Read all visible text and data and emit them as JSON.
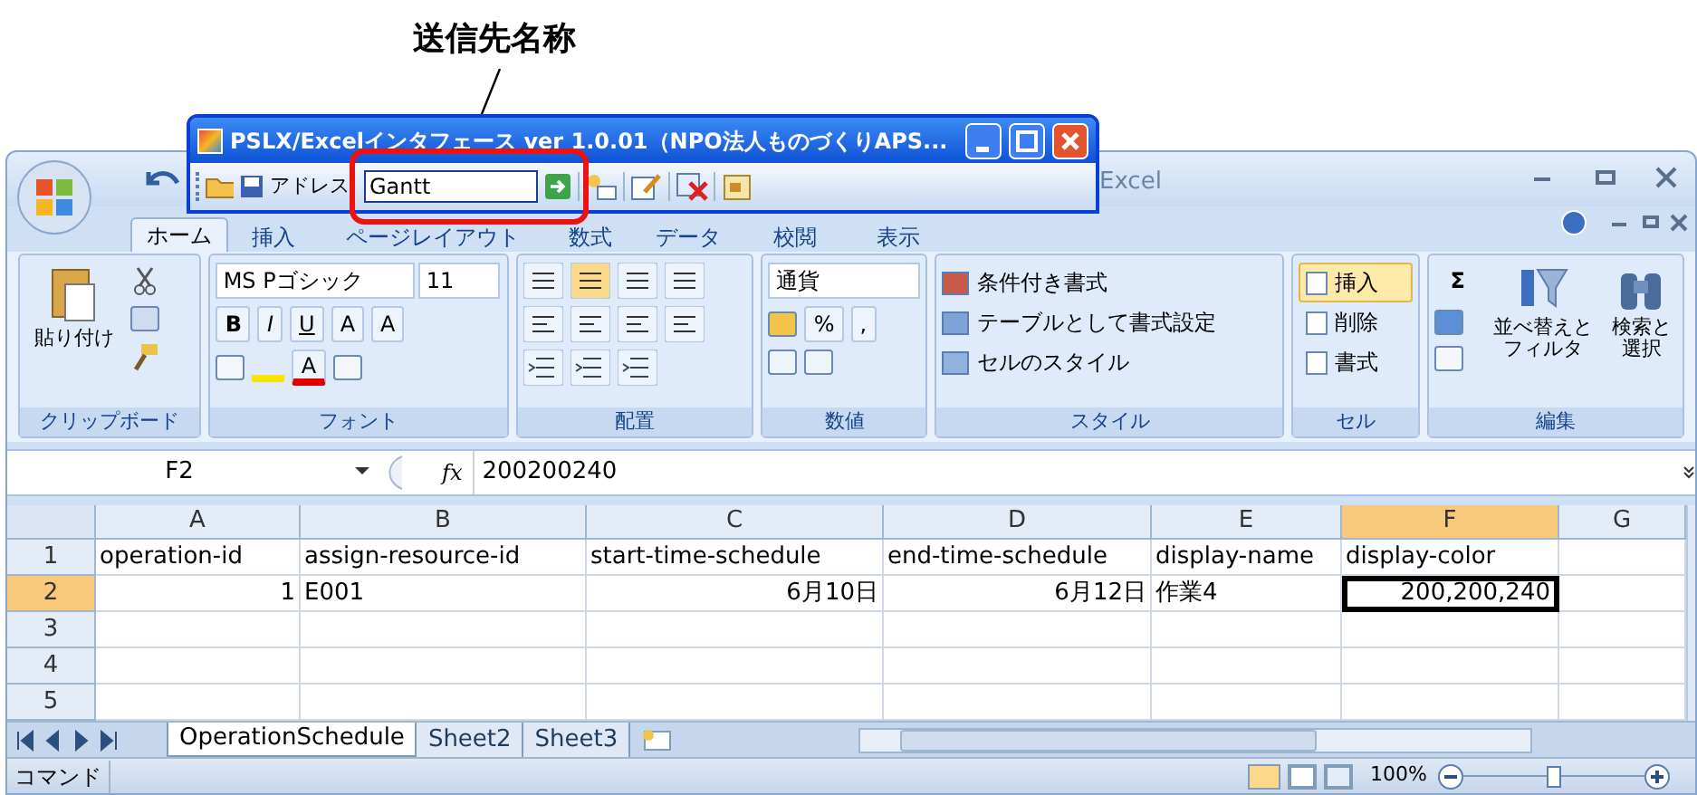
{
  "callout": {
    "label": "送信先名称"
  },
  "addin_window": {
    "title": "PSLX/Excelインタフェース ver 1.0.01（NPO法人ものづくりAPS...",
    "address_label": "アドレス",
    "address_value": "Gantt"
  },
  "excel": {
    "title": "Excel",
    "tabs": [
      {
        "label": "ホーム",
        "selected": true
      },
      {
        "label": "挿入",
        "selected": false
      },
      {
        "label": "ページレイアウト",
        "selected": false
      },
      {
        "label": "数式",
        "selected": false
      },
      {
        "label": "データ",
        "selected": false
      },
      {
        "label": "校閲",
        "selected": false
      },
      {
        "label": "表示",
        "selected": false
      }
    ],
    "ribbon": {
      "clipboard": {
        "paste": "貼り付け",
        "group": "クリップボード"
      },
      "font": {
        "name": "MS Pゴシック",
        "size": "11",
        "buttons": [
          "B",
          "I",
          "U",
          "A",
          "A"
        ],
        "color_button": "A",
        "group": "フォント"
      },
      "alignment": {
        "group": "配置"
      },
      "number": {
        "format": "通貨",
        "buttons": [
          "%",
          ","
        ],
        "group": "数値"
      },
      "styles": {
        "items": [
          "条件付き書式",
          "テーブルとして書式設定",
          "セルのスタイル"
        ],
        "group": "スタイル"
      },
      "cells": {
        "items": [
          {
            "label": "挿入",
            "selected": true
          },
          {
            "label": "削除",
            "selected": false
          },
          {
            "label": "書式",
            "selected": false
          }
        ],
        "group": "セル"
      },
      "editing": {
        "sigma": "Σ",
        "sort": "並べ替えとフィルタ",
        "find": "検索と選択",
        "group": "編集"
      }
    },
    "formula_bar": {
      "name_box": "F2",
      "fx": "fx",
      "value": "200200240"
    },
    "sheet": {
      "columns": [
        {
          "label": "A",
          "selected": false
        },
        {
          "label": "B",
          "selected": false
        },
        {
          "label": "C",
          "selected": false
        },
        {
          "label": "D",
          "selected": false
        },
        {
          "label": "E",
          "selected": false
        },
        {
          "label": "F",
          "selected": true
        },
        {
          "label": "G",
          "selected": false
        }
      ],
      "rows": [
        {
          "label": "1",
          "selected": false,
          "cells": [
            {
              "text": "operation-id",
              "kind": "text"
            },
            {
              "text": "assign-resource-id",
              "kind": "text"
            },
            {
              "text": "start-time-schedule",
              "kind": "text"
            },
            {
              "text": "end-time-schedule",
              "kind": "text"
            },
            {
              "text": "display-name",
              "kind": "text"
            },
            {
              "text": "display-color",
              "kind": "text"
            }
          ]
        },
        {
          "label": "2",
          "selected": true,
          "cells": [
            {
              "text": "1",
              "kind": "number"
            },
            {
              "text": "E001",
              "kind": "text"
            },
            {
              "text": "6月10日",
              "kind": "number"
            },
            {
              "text": "6月12日",
              "kind": "number"
            },
            {
              "text": "作業4",
              "kind": "text"
            },
            {
              "text": "200,200,240",
              "kind": "number"
            }
          ]
        },
        {
          "label": "3",
          "selected": false
        },
        {
          "label": "4",
          "selected": false
        },
        {
          "label": "5",
          "selected": false
        }
      ]
    },
    "sheet_tabs": [
      {
        "label": "OperationSchedule",
        "selected": true
      },
      {
        "label": "Sheet2",
        "selected": false
      },
      {
        "label": "Sheet3",
        "selected": false
      }
    ],
    "status_bar": {
      "mode": "コマンド",
      "zoom": "100%",
      "level": 0.5
    }
  }
}
